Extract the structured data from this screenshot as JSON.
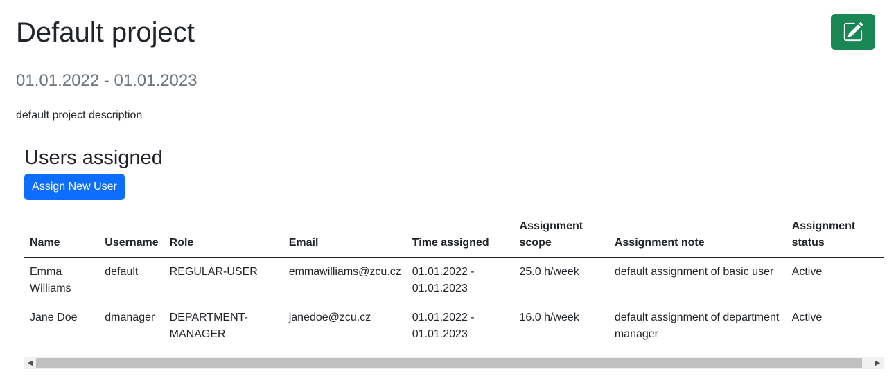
{
  "project": {
    "title": "Default project",
    "dates": "01.01.2022 - 01.01.2023",
    "description": "default project description",
    "edit_icon": "edit-square-icon"
  },
  "users_section": {
    "heading": "Users assigned",
    "assign_button": "Assign New User"
  },
  "table": {
    "headers": [
      "Name",
      "Username",
      "Role",
      "Email",
      "Time assigned",
      "Assignment scope",
      "Assignment note",
      "Assignment status"
    ],
    "rows": [
      [
        "Emma Williams",
        "default",
        "REGULAR-USER",
        "emmawilliams@zcu.cz",
        "01.01.2022 - 01.01.2023",
        "25.0 h/week",
        "default assignment of basic user",
        "Active"
      ],
      [
        "Jane Doe",
        "dmanager",
        "DEPARTMENT-MANAGER",
        "janedoe@zcu.cz",
        "01.01.2022 - 01.01.2023",
        "16.0 h/week",
        "default assignment of department manager",
        "Active"
      ]
    ]
  },
  "colors": {
    "edit_button": "#198754",
    "assign_button": "#0d6efd",
    "muted_text": "#6c757d"
  }
}
